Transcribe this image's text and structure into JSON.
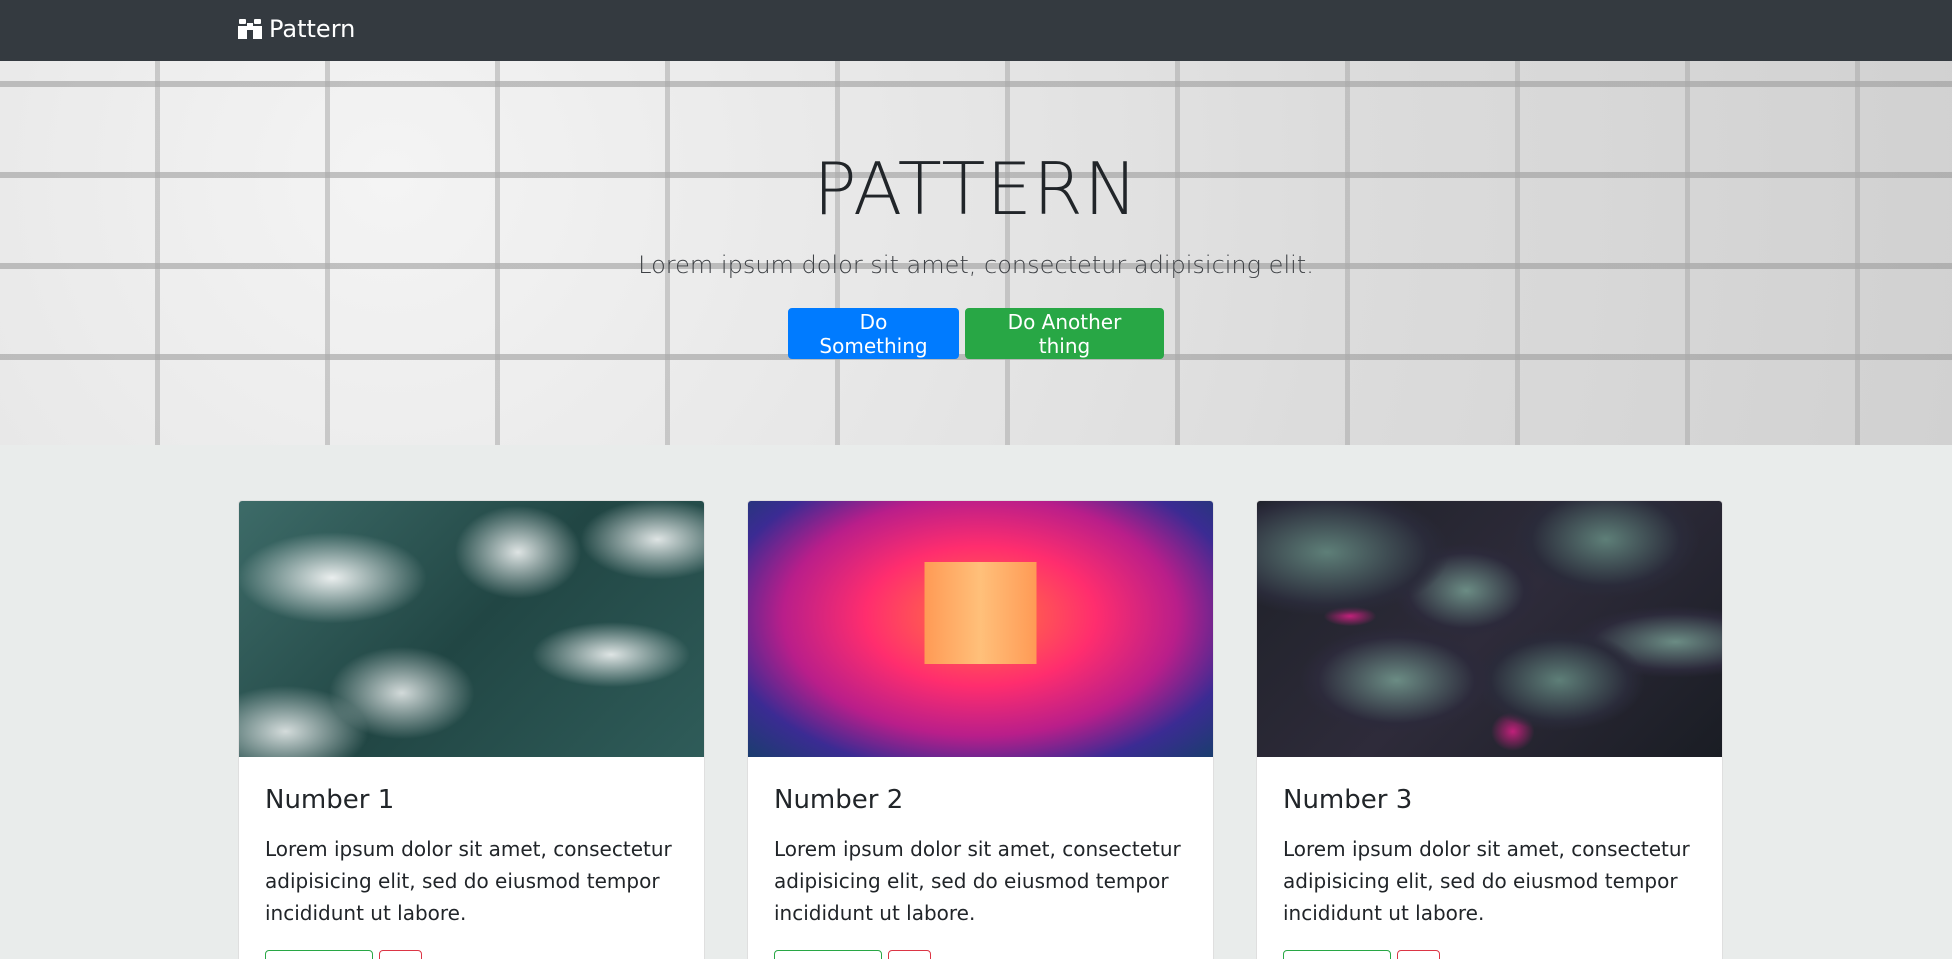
{
  "navbar": {
    "brand_icon": "binoculars-icon",
    "brand_label": "Pattern"
  },
  "hero": {
    "title": "PATTERN",
    "subtitle": "Lorem ipsum dolor sit amet, consectetur adipisicing elit.",
    "primary_button": "Do Something",
    "secondary_button": "Do Another thing"
  },
  "cards": [
    {
      "title": "Number 1",
      "text": "Lorem ipsum dolor sit amet, consectetur adipisicing elit, sed do eiusmod tempor incididunt ut labore.",
      "image": "ocean-water-photo"
    },
    {
      "title": "Number 2",
      "text": "Lorem ipsum dolor sit amet, consectetur adipisicing elit, sed do eiusmod tempor incididunt ut labore.",
      "image": "neon-tunnel-photo"
    },
    {
      "title": "Number 3",
      "text": "Lorem ipsum dolor sit amet, consectetur adipisicing elit, sed do eiusmod tempor incididunt ut labore.",
      "image": "coleus-leaves-photo"
    }
  ],
  "colors": {
    "navbar_bg": "#343a40",
    "page_bg": "#e9eceb",
    "primary": "#007bff",
    "success": "#28a745",
    "danger": "#dc3545"
  }
}
